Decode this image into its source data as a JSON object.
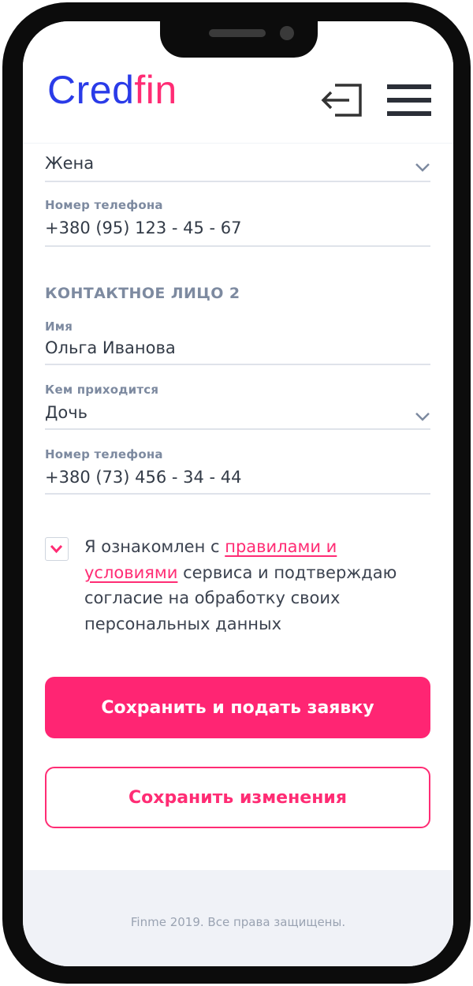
{
  "brand": {
    "logo_part1": "Cred",
    "logo_part2": "fin",
    "color_primary": "#2a3be8",
    "color_accent": "#ff2c74"
  },
  "header": {
    "login_icon": "login-icon",
    "menu_icon": "hamburger-menu-icon"
  },
  "contact1": {
    "relation_value": "Жена",
    "phone_label": "Номер телефона",
    "phone_value": "+380 (95) 123 - 45 - 67"
  },
  "contact2": {
    "section_title": "КОНТАКТНОЕ ЛИЦО 2",
    "name_label": "Имя",
    "name_value": "Ольга Иванова",
    "relation_label": "Кем приходится",
    "relation_value": "Дочь",
    "phone_label": "Номер телефона",
    "phone_value": "+380 (73) 456 - 34 - 44"
  },
  "consent": {
    "checked": true,
    "text_before": "Я ознакомлен с ",
    "link_text": "правилами и условиями",
    "text_after": " сервиса и подтверждаю согласие на обработку своих персональных данных"
  },
  "actions": {
    "submit_label": "Сохранить и подать заявку",
    "save_label": "Сохранить изменения"
  },
  "footer": {
    "copyright": "Finme 2019. Все права защищены."
  }
}
